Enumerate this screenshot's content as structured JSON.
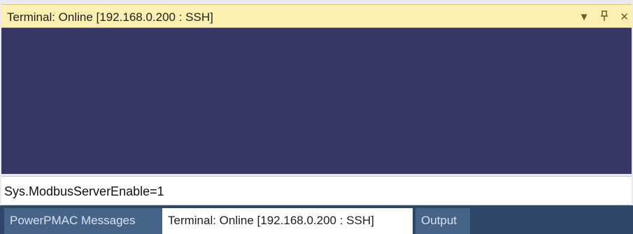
{
  "panel": {
    "title": "Terminal: Online [192.168.0.200 : SSH]",
    "controls": {
      "dropdown_icon": "▼",
      "pin_icon": "ᵃ",
      "close_icon": "✕"
    }
  },
  "terminal": {
    "input_value": "Sys.ModbusServerEnable=1"
  },
  "tabs": [
    {
      "label": "PowerPMAC Messages",
      "active": false
    },
    {
      "label": "Terminal: Online [192.168.0.200 : SSH]",
      "active": true
    },
    {
      "label": "Output",
      "active": false
    }
  ],
  "colors": {
    "title_bar": "#fcefb2",
    "terminal_background": "#363765",
    "tab_strip": "#2e4769",
    "inactive_tab": "#456488",
    "active_tab": "#ffffff"
  }
}
